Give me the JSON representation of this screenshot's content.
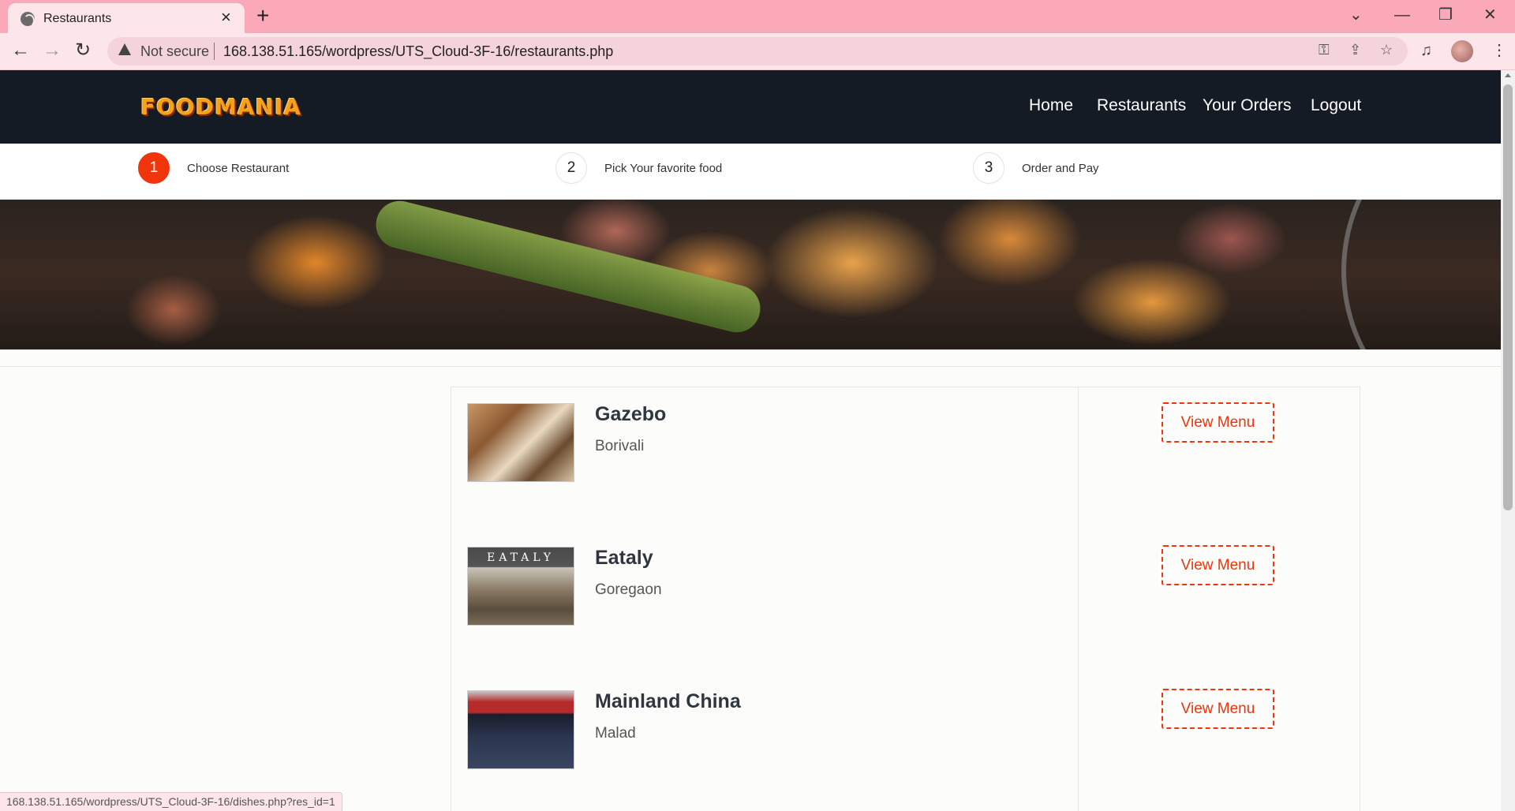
{
  "browser": {
    "tab_title": "Restaurants",
    "tab_icon": "globe-icon",
    "security_label": "Not secure",
    "url": "168.138.51.165/wordpress/UTS_Cloud-3F-16/restaurants.php",
    "status_url": "168.138.51.165/wordpress/UTS_Cloud-3F-16/dishes.php?res_id=1"
  },
  "site": {
    "logo_text": "FOODMANIA",
    "nav": [
      "Home",
      "Restaurants",
      "Your Orders",
      "Logout"
    ]
  },
  "steps": [
    {
      "number": "1",
      "label": "Choose Restaurant",
      "active": true
    },
    {
      "number": "2",
      "label": "Pick Your favorite food",
      "active": false
    },
    {
      "number": "3",
      "label": "Order and Pay",
      "active": false
    }
  ],
  "restaurants": [
    {
      "name": "Gazebo",
      "location": "Borivali",
      "button": "View Menu"
    },
    {
      "name": "Eataly",
      "location": "Goregaon",
      "button": "View Menu",
      "image_text": "EATALY"
    },
    {
      "name": "Mainland China",
      "location": "Malad",
      "button": "View Menu"
    }
  ],
  "colors": {
    "accent": "#f0350c",
    "header_bg": "#151b25",
    "browser_frame": "#fba8b8"
  }
}
